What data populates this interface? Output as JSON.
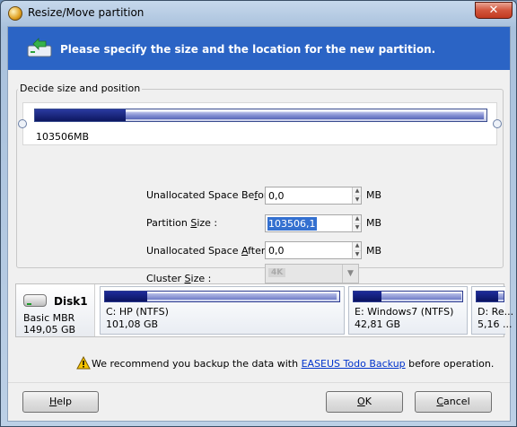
{
  "window": {
    "title": "Resize/Move partition",
    "close_glyph": "✕"
  },
  "banner": {
    "text": "Please specify the size and the location for the new partition.",
    "icon": "partition-wizard-icon"
  },
  "size_group": {
    "label": "Decide size and position",
    "partition_size_label": "103506MB",
    "used_fraction": 0.2
  },
  "fields": {
    "unalloc_before": {
      "pre": "Unallocated Space Be",
      "key": "f",
      "post": "ore:",
      "value": "0,0",
      "unit": "MB"
    },
    "partition_size": {
      "pre": "Partition ",
      "key": "S",
      "post": "ize :",
      "value": "103506,1",
      "unit": "MB"
    },
    "unalloc_after": {
      "pre": "Unallocated Space ",
      "key": "A",
      "post": "fter:",
      "value": "0,0",
      "unit": "MB"
    },
    "cluster_size": {
      "pre": "Cluster ",
      "key": "S",
      "post": "ize :",
      "value": "4K"
    }
  },
  "disk": {
    "name": "Disk1",
    "type": "Basic MBR",
    "capacity": "149,05 GB",
    "partitions": [
      {
        "name": "C: HP (NTFS)",
        "size": "101,08 GB",
        "used_fraction": 0.18
      },
      {
        "name": "E: Windows7 (NTFS)",
        "size": "42,81 GB",
        "used_fraction": 0.26
      },
      {
        "name": "D: Re...",
        "size": "5,16 ...",
        "used_fraction": 0.8
      }
    ]
  },
  "warning": {
    "pre": "We recommend you backup the data with ",
    "link": "EASEUS Todo Backup",
    "post": " before operation."
  },
  "buttons": {
    "help": {
      "key": "H",
      "rest": "elp"
    },
    "ok": {
      "key": "O",
      "rest": "K"
    },
    "cancel": {
      "pre": "",
      "key": "C",
      "rest": "ancel"
    }
  }
}
